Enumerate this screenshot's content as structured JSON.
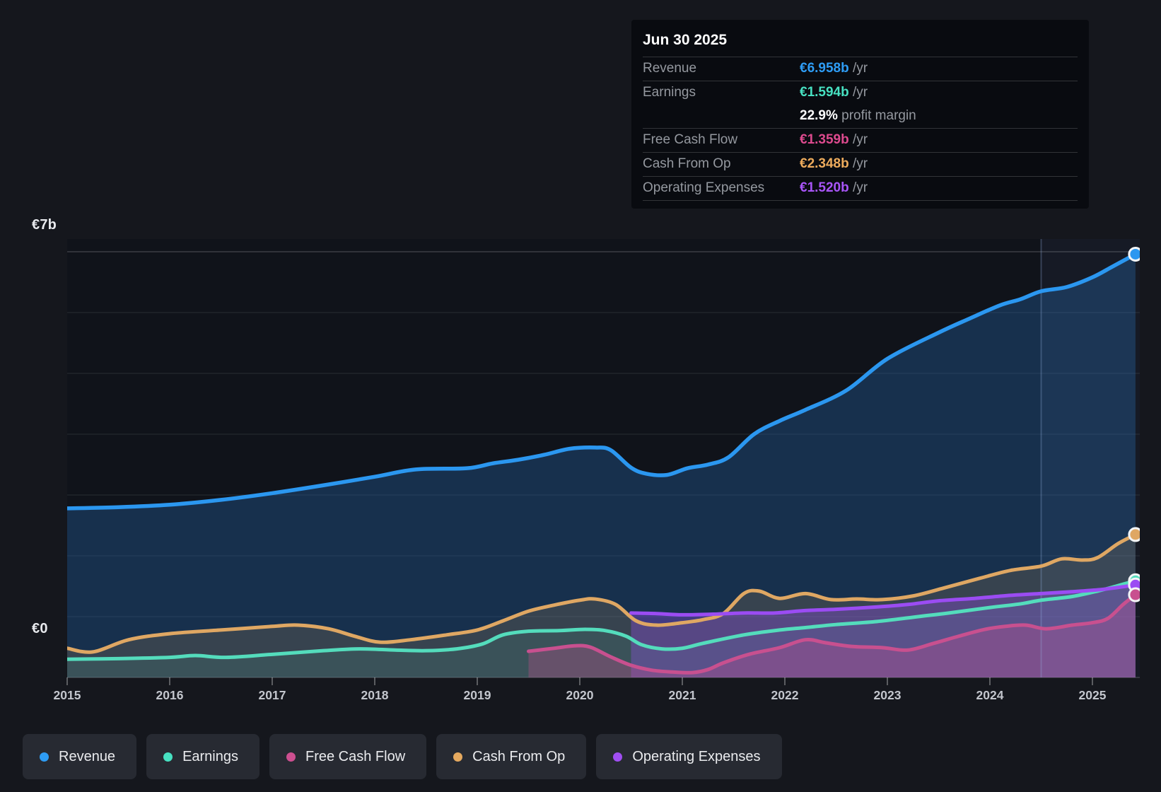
{
  "y_axis": {
    "top_label": "€7b",
    "zero_label": "€0"
  },
  "tooltip": {
    "date": "Jun 30 2025",
    "rows": [
      {
        "label": "Revenue",
        "value": "€6.958b",
        "suffix": " /yr",
        "color": "#2e9cf4"
      },
      {
        "label": "Earnings",
        "value": "€1.594b",
        "suffix": " /yr",
        "color": "#47e0c1"
      },
      {
        "label": "",
        "value": "22.9%",
        "suffix": " profit margin",
        "color": "#ffffff"
      },
      {
        "label": "Free Cash Flow",
        "value": "€1.359b",
        "suffix": " /yr",
        "color": "#dd4a8e"
      },
      {
        "label": "Cash From Op",
        "value": "€2.348b",
        "suffix": " /yr",
        "color": "#edab5c"
      },
      {
        "label": "Operating Expenses",
        "value": "€1.520b",
        "suffix": " /yr",
        "color": "#a855f7"
      }
    ]
  },
  "legend": {
    "items": [
      {
        "label": "Revenue",
        "color": "#2e9cf4"
      },
      {
        "label": "Earnings",
        "color": "#47e0c1"
      },
      {
        "label": "Free Cash Flow",
        "color": "#cd4f90"
      },
      {
        "label": "Cash From Op",
        "color": "#e5a95f"
      },
      {
        "label": "Operating Expenses",
        "color": "#a04ef2"
      }
    ]
  },
  "chart_data": {
    "type": "area",
    "title": "Earnings and Revenue History",
    "x_tick_years": [
      "2015",
      "2016",
      "2017",
      "2018",
      "2019",
      "2020",
      "2021",
      "2022",
      "2023",
      "2024",
      "2025"
    ],
    "x_range": [
      2015,
      2025.45
    ],
    "ylim": [
      0,
      7
    ],
    "y_unit": "€ billions",
    "grid": true,
    "gridline_values": [
      0,
      1,
      2,
      3,
      4,
      5,
      6,
      7
    ],
    "highlight_from_year": 2024.5,
    "legend_position": "bottom",
    "series": [
      {
        "name": "Revenue",
        "color": "#2b97f0",
        "fill": "rgba(40,115,195,0.30)",
        "points": [
          [
            2015,
            2.78
          ],
          [
            2015.5,
            2.8
          ],
          [
            2016,
            2.84
          ],
          [
            2016.5,
            2.92
          ],
          [
            2017,
            3.03
          ],
          [
            2017.5,
            3.16
          ],
          [
            2018,
            3.3
          ],
          [
            2018.4,
            3.42
          ],
          [
            2018.9,
            3.44
          ],
          [
            2019.15,
            3.52
          ],
          [
            2019.4,
            3.58
          ],
          [
            2019.65,
            3.66
          ],
          [
            2019.9,
            3.76
          ],
          [
            2020.15,
            3.78
          ],
          [
            2020.3,
            3.74
          ],
          [
            2020.5,
            3.45
          ],
          [
            2020.65,
            3.35
          ],
          [
            2020.85,
            3.33
          ],
          [
            2021.05,
            3.44
          ],
          [
            2021.25,
            3.5
          ],
          [
            2021.45,
            3.62
          ],
          [
            2021.7,
            4.0
          ],
          [
            2021.95,
            4.22
          ],
          [
            2022.2,
            4.4
          ],
          [
            2022.6,
            4.72
          ],
          [
            2023,
            5.24
          ],
          [
            2023.5,
            5.67
          ],
          [
            2023.8,
            5.9
          ],
          [
            2024.1,
            6.12
          ],
          [
            2024.3,
            6.22
          ],
          [
            2024.5,
            6.35
          ],
          [
            2024.75,
            6.42
          ],
          [
            2025,
            6.58
          ],
          [
            2025.2,
            6.76
          ],
          [
            2025.42,
            6.96
          ]
        ]
      },
      {
        "name": "Cash From Op",
        "color": "#dfa763",
        "fill": "rgba(226,169,95,0.16)",
        "points": [
          [
            2015,
            0.48
          ],
          [
            2015.25,
            0.42
          ],
          [
            2015.6,
            0.62
          ],
          [
            2016,
            0.72
          ],
          [
            2016.5,
            0.78
          ],
          [
            2017,
            0.84
          ],
          [
            2017.25,
            0.86
          ],
          [
            2017.55,
            0.8
          ],
          [
            2017.8,
            0.68
          ],
          [
            2018.05,
            0.58
          ],
          [
            2018.35,
            0.62
          ],
          [
            2018.7,
            0.7
          ],
          [
            2019,
            0.78
          ],
          [
            2019.25,
            0.93
          ],
          [
            2019.5,
            1.09
          ],
          [
            2019.75,
            1.19
          ],
          [
            2020,
            1.27
          ],
          [
            2020.15,
            1.29
          ],
          [
            2020.35,
            1.2
          ],
          [
            2020.55,
            0.93
          ],
          [
            2020.75,
            0.86
          ],
          [
            2021,
            0.9
          ],
          [
            2021.2,
            0.95
          ],
          [
            2021.4,
            1.05
          ],
          [
            2021.6,
            1.38
          ],
          [
            2021.75,
            1.42
          ],
          [
            2021.95,
            1.3
          ],
          [
            2022.2,
            1.38
          ],
          [
            2022.45,
            1.28
          ],
          [
            2022.7,
            1.29
          ],
          [
            2022.95,
            1.28
          ],
          [
            2023.25,
            1.34
          ],
          [
            2023.55,
            1.47
          ],
          [
            2023.9,
            1.63
          ],
          [
            2024.2,
            1.76
          ],
          [
            2024.5,
            1.83
          ],
          [
            2024.7,
            1.95
          ],
          [
            2024.9,
            1.93
          ],
          [
            2025.05,
            1.97
          ],
          [
            2025.25,
            2.2
          ],
          [
            2025.42,
            2.35
          ]
        ]
      },
      {
        "name": "Earnings",
        "color": "#54dcbc",
        "fill": "rgba(85,215,185,0.10)",
        "points": [
          [
            2015,
            0.3
          ],
          [
            2015.5,
            0.31
          ],
          [
            2016,
            0.33
          ],
          [
            2016.25,
            0.36
          ],
          [
            2016.55,
            0.33
          ],
          [
            2017,
            0.38
          ],
          [
            2017.5,
            0.44
          ],
          [
            2017.85,
            0.47
          ],
          [
            2018.2,
            0.45
          ],
          [
            2018.5,
            0.44
          ],
          [
            2018.8,
            0.47
          ],
          [
            2019.05,
            0.55
          ],
          [
            2019.25,
            0.7
          ],
          [
            2019.5,
            0.76
          ],
          [
            2019.8,
            0.77
          ],
          [
            2020.05,
            0.79
          ],
          [
            2020.25,
            0.77
          ],
          [
            2020.45,
            0.68
          ],
          [
            2020.6,
            0.54
          ],
          [
            2020.8,
            0.47
          ],
          [
            2021,
            0.48
          ],
          [
            2021.2,
            0.56
          ],
          [
            2021.6,
            0.7
          ],
          [
            2021.95,
            0.78
          ],
          [
            2022.2,
            0.82
          ],
          [
            2022.5,
            0.87
          ],
          [
            2022.9,
            0.92
          ],
          [
            2023.3,
            1.0
          ],
          [
            2023.6,
            1.06
          ],
          [
            2024,
            1.15
          ],
          [
            2024.3,
            1.21
          ],
          [
            2024.5,
            1.27
          ],
          [
            2024.8,
            1.33
          ],
          [
            2025.05,
            1.42
          ],
          [
            2025.25,
            1.51
          ],
          [
            2025.42,
            1.59
          ]
        ]
      },
      {
        "name": "Operating Expenses",
        "color": "#9b4cf3",
        "fill": "rgba(150,80,235,0.34)",
        "points": [
          [
            2020.5,
            1.06
          ],
          [
            2020.75,
            1.05
          ],
          [
            2021,
            1.03
          ],
          [
            2021.3,
            1.04
          ],
          [
            2021.6,
            1.06
          ],
          [
            2021.9,
            1.06
          ],
          [
            2022.2,
            1.1
          ],
          [
            2022.5,
            1.12
          ],
          [
            2022.9,
            1.16
          ],
          [
            2023.2,
            1.2
          ],
          [
            2023.5,
            1.26
          ],
          [
            2023.85,
            1.3
          ],
          [
            2024.2,
            1.35
          ],
          [
            2024.5,
            1.38
          ],
          [
            2024.8,
            1.41
          ],
          [
            2025.05,
            1.44
          ],
          [
            2025.25,
            1.48
          ],
          [
            2025.42,
            1.52
          ]
        ]
      },
      {
        "name": "Free Cash Flow",
        "color": "#c8508f",
        "fill": "rgba(205,80,145,0.30)",
        "points": [
          [
            2019.5,
            0.43
          ],
          [
            2019.75,
            0.48
          ],
          [
            2019.95,
            0.52
          ],
          [
            2020.1,
            0.5
          ],
          [
            2020.3,
            0.34
          ],
          [
            2020.5,
            0.2
          ],
          [
            2020.7,
            0.12
          ],
          [
            2020.9,
            0.09
          ],
          [
            2021.1,
            0.08
          ],
          [
            2021.25,
            0.13
          ],
          [
            2021.4,
            0.24
          ],
          [
            2021.65,
            0.38
          ],
          [
            2021.95,
            0.49
          ],
          [
            2022.2,
            0.62
          ],
          [
            2022.4,
            0.57
          ],
          [
            2022.65,
            0.51
          ],
          [
            2022.95,
            0.49
          ],
          [
            2023.2,
            0.45
          ],
          [
            2023.45,
            0.56
          ],
          [
            2023.7,
            0.68
          ],
          [
            2023.95,
            0.79
          ],
          [
            2024.15,
            0.84
          ],
          [
            2024.35,
            0.86
          ],
          [
            2024.55,
            0.8
          ],
          [
            2024.8,
            0.86
          ],
          [
            2025,
            0.9
          ],
          [
            2025.15,
            0.97
          ],
          [
            2025.3,
            1.2
          ],
          [
            2025.42,
            1.36
          ]
        ]
      }
    ]
  }
}
